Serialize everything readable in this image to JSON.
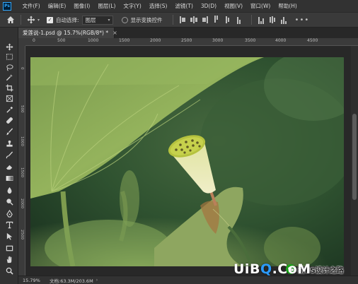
{
  "app": {
    "logo": "Ps"
  },
  "menu": [
    "文件(F)",
    "编辑(E)",
    "图像(I)",
    "图层(L)",
    "文字(Y)",
    "选择(S)",
    "滤镜(T)",
    "3D(D)",
    "视图(V)",
    "窗口(W)",
    "帮助(H)"
  ],
  "options": {
    "auto_select_label": "自动选择:",
    "auto_select_checked": true,
    "auto_select_target": "图层",
    "show_transform_label": "显示变换控件",
    "more": "•••"
  },
  "document": {
    "tab_title": "爱莲说-1.psd @ 15.7%(RGB/8*) *",
    "close_glyph": "×"
  },
  "ruler_top": [
    "0",
    "500",
    "1000",
    "1500",
    "2000",
    "2500",
    "3000",
    "3500",
    "4000",
    "4500"
  ],
  "ruler_left": [
    "0",
    "500",
    "1000",
    "1500",
    "2000",
    "2500"
  ],
  "status": {
    "zoom": "15.79%",
    "doc_info": "文档:63.3M/203.6M",
    "arrow": "›"
  },
  "watermark": {
    "logo_part1": "UiB",
    "logo_part2": "Q",
    "logo_part3": ".CoM",
    "text": "新PS设计之路"
  },
  "tools": [
    "move-tool-icon",
    "marquee-tool-icon",
    "lasso-tool-icon",
    "magic-wand-tool-icon",
    "crop-tool-icon",
    "frame-tool-icon",
    "eyedropper-tool-icon",
    "healing-brush-tool-icon",
    "brush-tool-icon",
    "clone-stamp-tool-icon",
    "history-brush-tool-icon",
    "eraser-tool-icon",
    "gradient-tool-icon",
    "blur-tool-icon",
    "dodge-tool-icon",
    "pen-tool-icon",
    "type-tool-icon",
    "path-selection-tool-icon",
    "rectangle-tool-icon",
    "hand-tool-icon",
    "zoom-tool-icon"
  ],
  "colors": {
    "accent": "#31a8ff",
    "ui_dark": "#323232",
    "canvas_bg": "#282828"
  }
}
